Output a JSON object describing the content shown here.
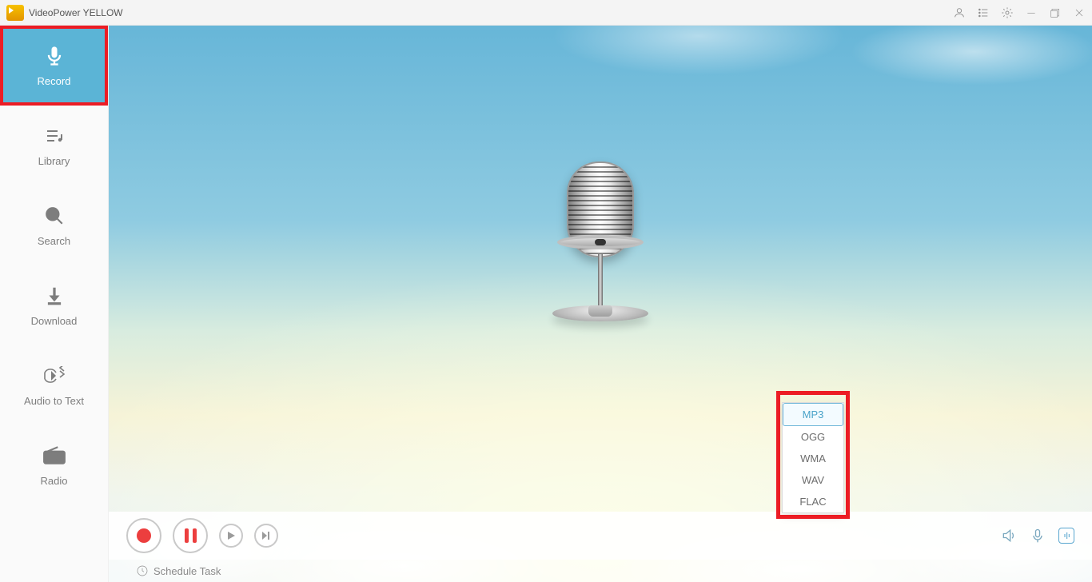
{
  "app": {
    "title": "VideoPower YELLOW"
  },
  "sidebar": {
    "items": [
      {
        "label": "Record"
      },
      {
        "label": "Library"
      },
      {
        "label": "Search"
      },
      {
        "label": "Download"
      },
      {
        "label": "Audio to Text"
      },
      {
        "label": "Radio"
      }
    ]
  },
  "format_menu": {
    "options": [
      "MP3",
      "OGG",
      "WMA",
      "WAV",
      "FLAC"
    ],
    "selected": "MP3"
  },
  "statusbar": {
    "schedule_label": "Schedule Task"
  }
}
